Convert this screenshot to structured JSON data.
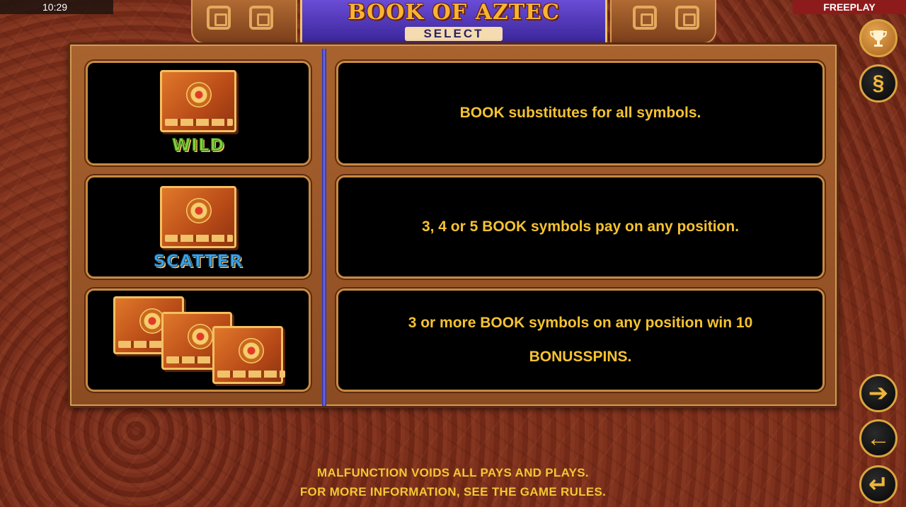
{
  "status": {
    "time": "10:29",
    "mode": "FREEPLAY"
  },
  "logo": {
    "title": "BOOK OF AZTEC",
    "subtitle": "SELECT"
  },
  "paytable": [
    {
      "symbol_label": "WILD",
      "description": "BOOK substitutes for all symbols."
    },
    {
      "symbol_label": "SCATTER",
      "description": "3, 4 or 5 BOOK symbols pay on any position."
    },
    {
      "symbol_label": "",
      "description_line1": "3 or more BOOK symbols on any position win 10",
      "description_line2": "BONUSSPINS."
    }
  ],
  "footer": {
    "line1": "MALFUNCTION VOIDS ALL PAYS AND PLAYS.",
    "line2": "FOR MORE INFORMATION, SEE THE GAME RULES."
  },
  "buttons": {
    "trophy_icon": "trophy-icon",
    "paragraph_icon": "§",
    "next_icon": "➔",
    "prev_icon": "←",
    "back_icon": "↵"
  },
  "colors": {
    "text_gold": "#f5c232",
    "freeplay_bg": "#8e1b1b",
    "divider_blue": "#4a4ad8"
  }
}
